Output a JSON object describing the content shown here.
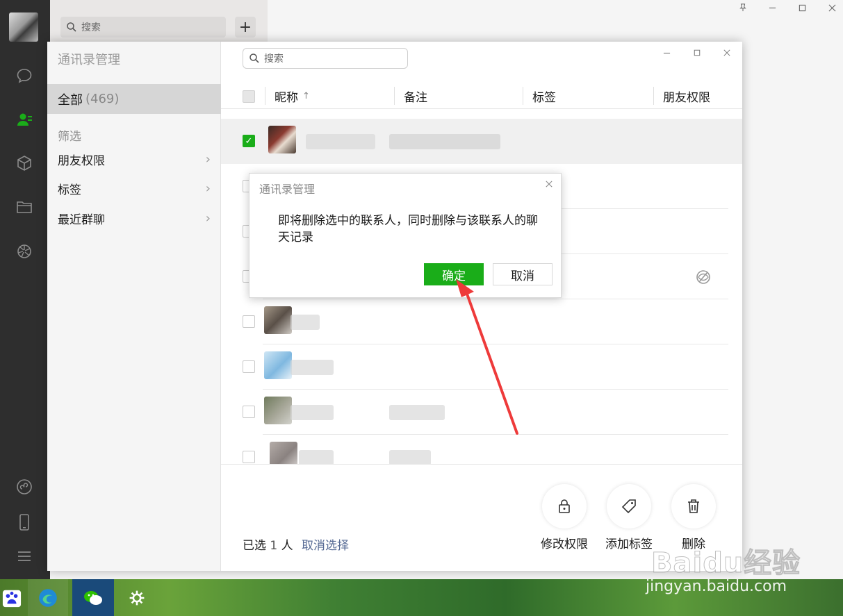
{
  "main_window": {
    "search_placeholder": "搜索",
    "add_label": "+"
  },
  "manager": {
    "title": "通讯录管理",
    "all_label": "全部",
    "all_count": "(469)",
    "filter_label": "筛选",
    "filters": [
      {
        "label": "朋友权限"
      },
      {
        "label": "标签"
      },
      {
        "label": "最近群聊"
      }
    ],
    "search_placeholder": "搜索",
    "columns": {
      "nickname": "昵称",
      "sort_arrow": "↑",
      "remark": "备注",
      "tag": "标签",
      "permission": "朋友权限"
    },
    "selected_prefix": "已选",
    "selected_count": "1",
    "selected_suffix": "人",
    "cancel_select": "取消选择",
    "actions": {
      "modify_permission": "修改权限",
      "add_tag": "添加标签",
      "delete": "删除"
    }
  },
  "dialog": {
    "title": "通讯录管理",
    "message": "即将删除选中的联系人，同时删除与该联系人的聊天记录",
    "ok": "确定",
    "cancel": "取消"
  },
  "watermark": {
    "brand": "Baidu经验",
    "url": "jingyan.baidu.com"
  },
  "colors": {
    "accent_green": "#1aad19",
    "link_blue": "#576b95",
    "arrow_red": "#ee3a3a"
  },
  "icons": [
    "search-icon",
    "chat-icon",
    "contacts-icon",
    "box-icon",
    "folder-icon",
    "moments-icon",
    "miniprogram-icon",
    "phone-icon",
    "menu-icon",
    "lock-icon",
    "tag-icon",
    "trash-icon",
    "close-icon"
  ]
}
